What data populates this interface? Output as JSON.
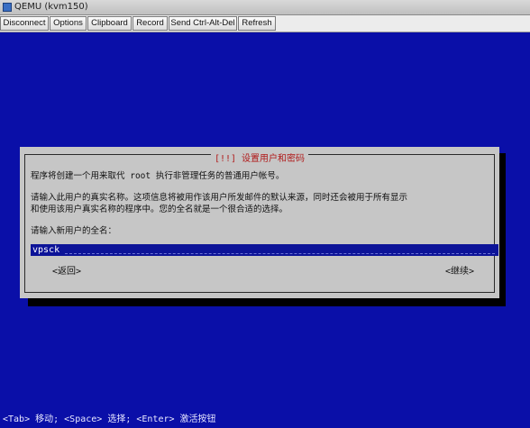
{
  "window": {
    "title": "QEMU (kvm150)",
    "app_icon": "qemu-icon"
  },
  "toolbar": {
    "buttons": [
      {
        "label": "Disconnect"
      },
      {
        "label": "Options"
      },
      {
        "label": "Clipboard"
      },
      {
        "label": "Record"
      },
      {
        "label": "Send Ctrl-Alt-Del"
      },
      {
        "label": "Refresh"
      }
    ]
  },
  "screen": {
    "background_color": "#0a0fa8"
  },
  "dialog": {
    "title": "[!!] 设置用户和密码",
    "line1": "程序将创建一个用来取代 root 执行非管理任务的普通用户帐号。",
    "line2": "请输入此用户的真实名称。这项信息将被用作该用户所发邮件的默认来源，同时还会被用于所有显示",
    "line3": "和使用该用户真实名称的程序中。您的全名就是一个很合适的选择。",
    "prompt": "请输入新用户的全名：",
    "entry_value": "vpsck",
    "back_button": "<返回>",
    "continue_button": "<继续>"
  },
  "status_bar": {
    "text": "<Tab> 移动; <Space> 选择; <Enter> 激活按钮"
  }
}
